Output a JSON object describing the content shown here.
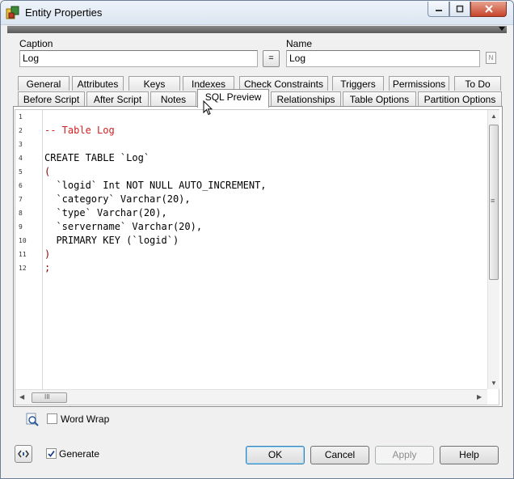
{
  "window": {
    "title": "Entity Properties"
  },
  "form": {
    "caption_label": "Caption",
    "caption_value": "Log",
    "equal_button": "=",
    "name_label": "Name",
    "name_value": "Log",
    "name_icon_label": "N"
  },
  "tabs": {
    "row1": [
      "General",
      "Attributes",
      "Keys",
      "Indexes",
      "Check Constraints",
      "Triggers",
      "Permissions",
      "To Do"
    ],
    "row2": [
      "Before Script",
      "After Script",
      "Notes",
      "SQL Preview",
      "Relationships",
      "Table Options",
      "Partition Options"
    ],
    "active": "SQL Preview"
  },
  "editor": {
    "line_numbers": [
      "1",
      "2",
      "3",
      "4",
      "5",
      "6",
      "7",
      "8",
      "9",
      "10",
      "11",
      "12"
    ],
    "lines": [
      "",
      "-- Table Log",
      "",
      "CREATE TABLE `Log`",
      "(",
      "  `logid` Int NOT NULL AUTO_INCREMENT,",
      "  `category` Varchar(20),",
      "  `type` Varchar(20),",
      "  `servername` Varchar(20),",
      "  PRIMARY KEY (`logid`)",
      ")",
      ";"
    ],
    "hscroll_thumb_glyph": "III",
    "vscroll_thumb_glyph": "≡"
  },
  "options": {
    "word_wrap_label": "Word Wrap",
    "word_wrap_checked": false,
    "generate_label": "Generate",
    "generate_checked": true
  },
  "buttons": {
    "ok": "OK",
    "cancel": "Cancel",
    "apply": "Apply",
    "help": "Help"
  },
  "colors": {
    "comment": "#d02020",
    "paren": "#8b0000",
    "active_tab": "#ffffff"
  }
}
